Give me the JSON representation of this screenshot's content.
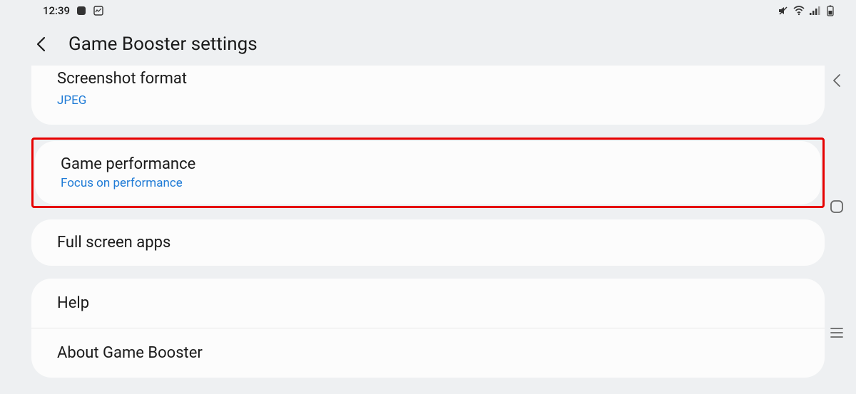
{
  "status_bar": {
    "time": "12:39"
  },
  "header": {
    "title": "Game Booster settings"
  },
  "items": {
    "screenshot_format": {
      "title": "Screenshot format",
      "value": "JPEG"
    },
    "game_performance": {
      "title": "Game performance",
      "value": "Focus on performance"
    },
    "full_screen_apps": {
      "title": "Full screen apps"
    },
    "help": {
      "title": "Help"
    },
    "about": {
      "title": "About Game Booster"
    }
  }
}
